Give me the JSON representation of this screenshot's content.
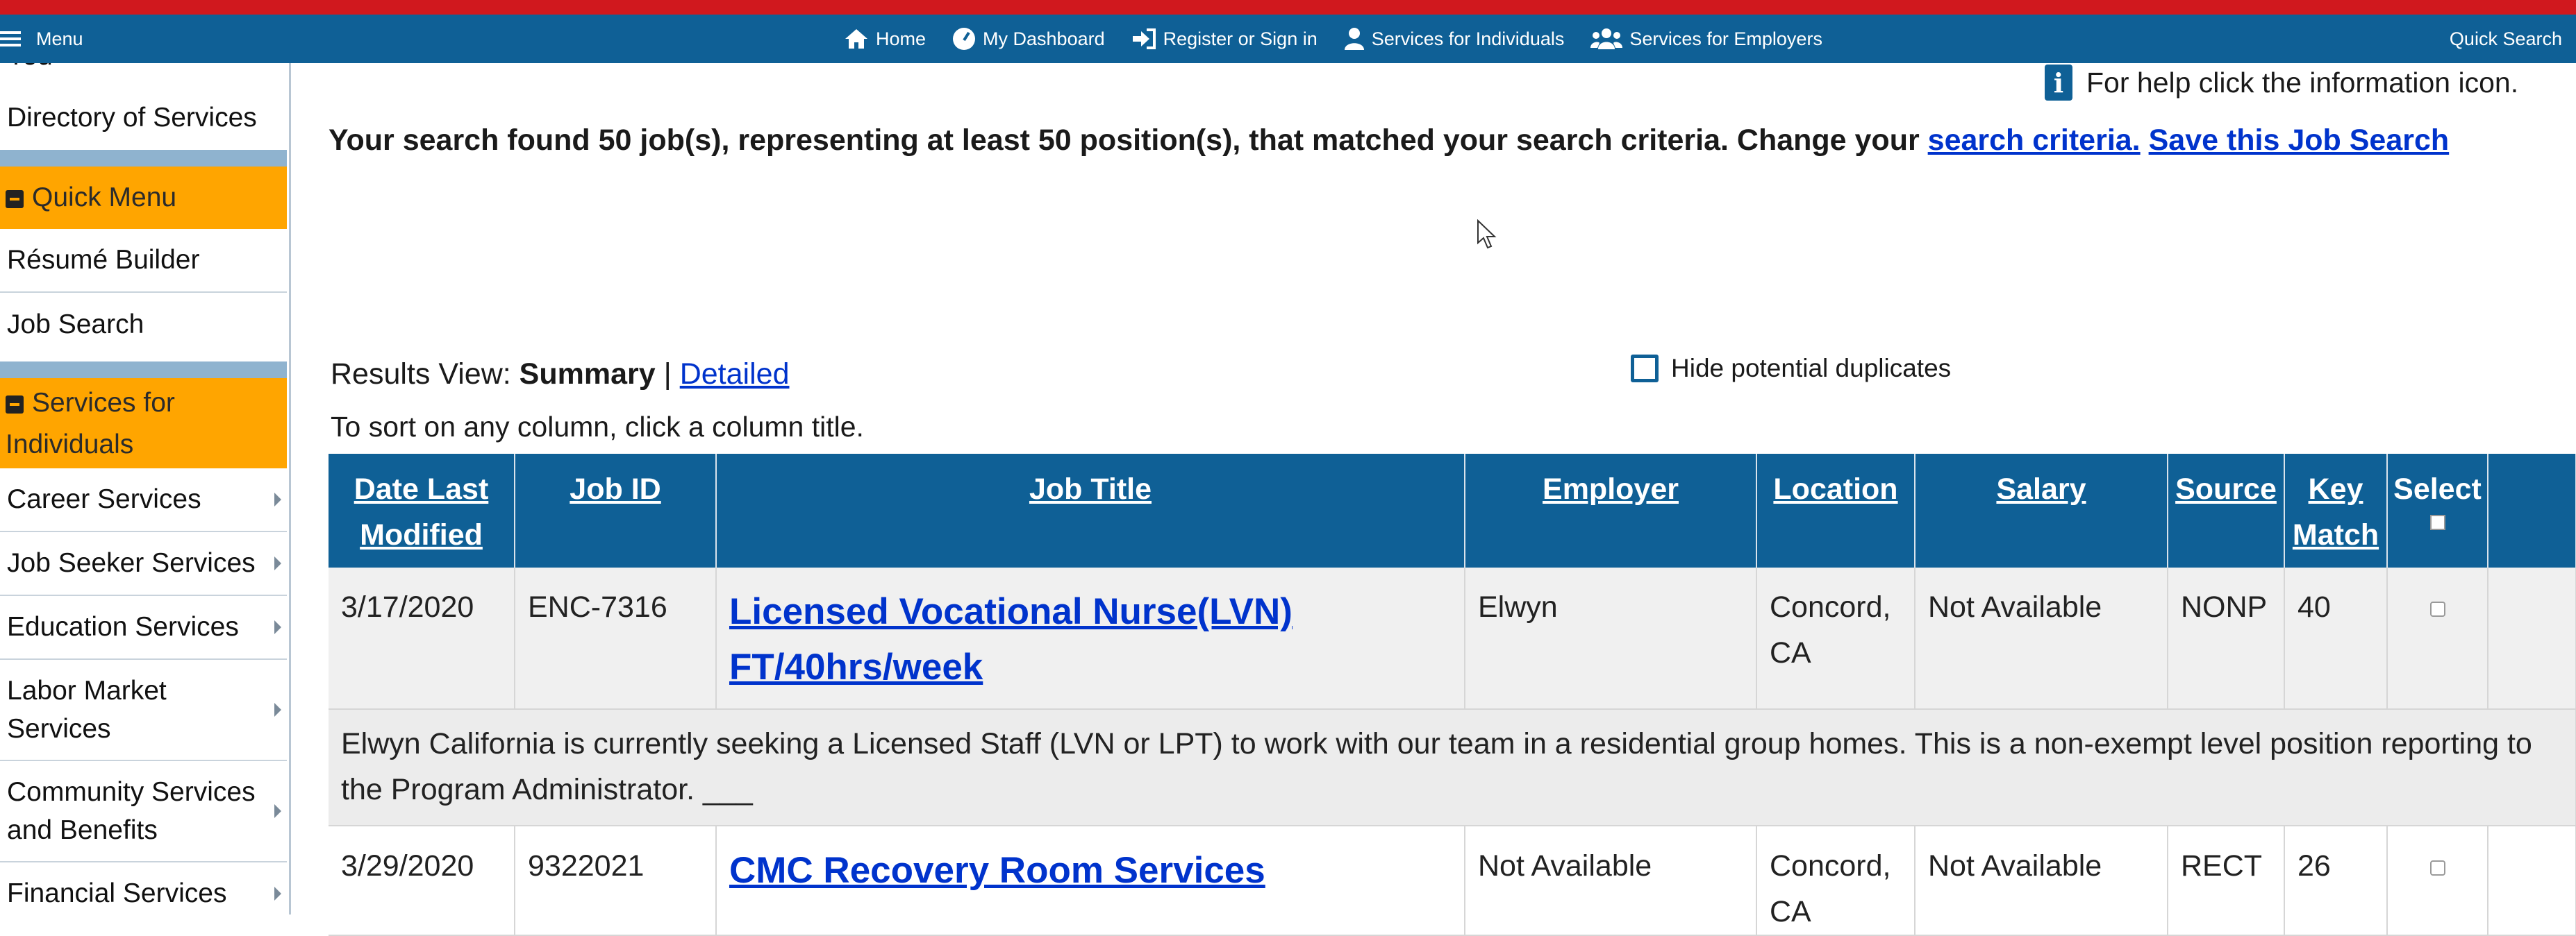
{
  "nav": {
    "menu_label": "Menu",
    "items": [
      {
        "label": "Home",
        "icon": "home-icon"
      },
      {
        "label": "My Dashboard",
        "icon": "dashboard-icon"
      },
      {
        "label": "Register or Sign in",
        "icon": "sign-in-icon"
      },
      {
        "label": "Services for Individuals",
        "icon": "user-icon"
      },
      {
        "label": "Services for Employers",
        "icon": "users-icon"
      }
    ],
    "quick_search": "Quick Search"
  },
  "sidebar": {
    "partial_top": "You",
    "directory": "Directory of Services",
    "quick_menu": {
      "title": "Quick Menu",
      "items": [
        "Résumé Builder",
        "Job Search"
      ]
    },
    "services": {
      "title": "Services for Individuals",
      "items": [
        "Career Services",
        "Job Seeker Services",
        "Education Services",
        "Labor Market Services",
        "Community Services and Benefits",
        "Financial Services"
      ]
    }
  },
  "help_text": "For help click the information icon.",
  "summary": {
    "text": "Your search found 50 job(s), representing at least 50 position(s), that matched your search criteria. Change your",
    "criteria_link": "search criteria.",
    "save_link": "Save this Job Search"
  },
  "results_view": {
    "label": "Results View:",
    "current": "Summary",
    "separator": "|",
    "alt": "Detailed"
  },
  "sort_hint": "To sort on any column, click a column title.",
  "hide_duplicates": "Hide potential duplicates",
  "table": {
    "headers": {
      "date": "Date Last Modified",
      "job_id": "Job ID",
      "title": "Job Title",
      "employer": "Employer",
      "location": "Location",
      "salary": "Salary",
      "source": "Source",
      "key_match": "Key Match",
      "select": "Select"
    },
    "rows": [
      {
        "date": "3/17/2020",
        "job_id": "ENC-7316",
        "title": "Licensed Vocational Nurse(LVN) FT/40hrs/week",
        "employer": "Elwyn",
        "location": "Concord, CA",
        "salary": "Not Available",
        "source": "NONP",
        "key_match": "40",
        "description": "Elwyn California is currently seeking a Licensed Staff (LVN or LPT) to work with our team in a residential group homes. This is a non-exempt level position reporting to the Program Administrator. ___"
      },
      {
        "date": "3/29/2020",
        "job_id": "9322021",
        "title": "CMC Recovery Room Services",
        "employer": "Not Available",
        "location": "Concord, CA",
        "salary": "Not Available",
        "source": "RECT",
        "key_match": "26"
      }
    ]
  }
}
